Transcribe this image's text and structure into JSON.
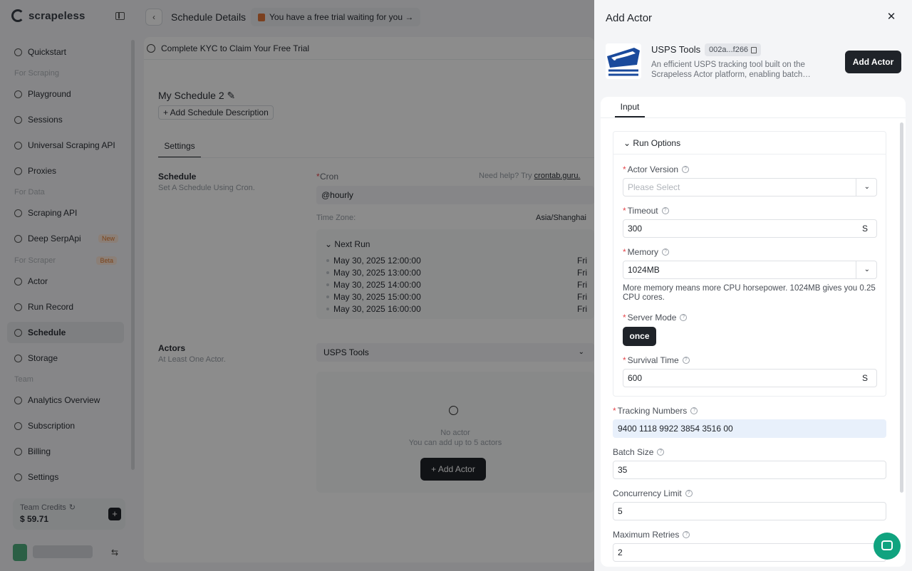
{
  "sidebar": {
    "brand": "scrapeless",
    "items": [
      {
        "label": "Quickstart",
        "icon": "rocket-icon"
      },
      {
        "label": "Playground",
        "icon": "grid-icon"
      },
      {
        "label": "Sessions",
        "icon": "session-icon"
      },
      {
        "label": "Universal Scraping API",
        "icon": "lock-icon"
      },
      {
        "label": "Proxies",
        "icon": "globe-icon"
      },
      {
        "label": "Scraping API",
        "icon": "api-icon"
      },
      {
        "label": "Deep SerpApi",
        "icon": "search-icon",
        "badge": "New"
      },
      {
        "label": "Actor",
        "icon": "actor-icon"
      },
      {
        "label": "Run Record",
        "icon": "record-icon"
      },
      {
        "label": "Schedule",
        "icon": "clock-icon"
      },
      {
        "label": "Storage",
        "icon": "storage-icon"
      },
      {
        "label": "Analytics Overview",
        "icon": "chart-icon"
      },
      {
        "label": "Subscription",
        "icon": "subscription-icon"
      },
      {
        "label": "Billing",
        "icon": "billing-icon"
      },
      {
        "label": "Settings",
        "icon": "gear-icon"
      }
    ],
    "groups": {
      "scraping": "For Scraping",
      "data": "For Data",
      "scraper": "For Scraper",
      "scraper_badge": "Beta",
      "team": "Team"
    },
    "credits": {
      "label": "Team Credits",
      "value": "$ 59.71"
    }
  },
  "topbar": {
    "title": "Schedule Details",
    "trial": "You have a free trial waiting for you →"
  },
  "main": {
    "kyc": "Complete KYC to Claim Your Free Trial",
    "schedule_name": "My Schedule 2",
    "add_description": "+ Add Schedule Description",
    "tab": "Settings",
    "schedule_title": "Schedule",
    "schedule_sub": "Set A Schedule Using Cron.",
    "cron_label": "Cron",
    "cron_help": "Need help? Try",
    "cron_link": "crontab.guru.",
    "cron_value": "@hourly",
    "timezone_label": "Time Zone:",
    "timezone_value": "Asia/Shanghai",
    "next_run_title": "Next Run",
    "next_runs": [
      {
        "time": "May 30, 2025 12:00:00",
        "day": "Fri"
      },
      {
        "time": "May 30, 2025 13:00:00",
        "day": "Fri"
      },
      {
        "time": "May 30, 2025 14:00:00",
        "day": "Fri"
      },
      {
        "time": "May 30, 2025 15:00:00",
        "day": "Fri"
      },
      {
        "time": "May 30, 2025 16:00:00",
        "day": "Fri"
      }
    ],
    "actors_title": "Actors",
    "actors_sub": "At Least One Actor.",
    "actors_selected": "USPS Tools",
    "empty_title": "No actor",
    "empty_sub": "You can add up to 5 actors",
    "add_actor": "+ Add Actor"
  },
  "drawer": {
    "title": "Add Actor",
    "actor": {
      "name": "USPS Tools",
      "id": "002a...f266",
      "description": "An efficient USPS tracking tool built on the Scrapeless Actor platform, enabling batch…",
      "logo_text": "UNITED STATES POSTAL SERVICE"
    },
    "add_button": "Add Actor",
    "tab": "Input",
    "run_options": "Run Options",
    "fields": {
      "actor_version": {
        "label": "Actor Version",
        "placeholder": "Please Select"
      },
      "timeout": {
        "label": "Timeout",
        "value": "300",
        "suffix": "S"
      },
      "memory": {
        "label": "Memory",
        "value": "1024MB",
        "help": "More memory means more CPU horsepower. 1024MB gives you 0.25 CPU cores."
      },
      "server_mode": {
        "label": "Server Mode",
        "value": "once"
      },
      "survival_time": {
        "label": "Survival Time",
        "value": "600",
        "suffix": "S"
      },
      "tracking_numbers": {
        "label": "Tracking Numbers",
        "value": "9400 1118 9922 3854 3516 00"
      },
      "batch_size": {
        "label": "Batch Size",
        "value": "35"
      },
      "concurrency_limit": {
        "label": "Concurrency Limit",
        "value": "5"
      },
      "maximum_retries": {
        "label": "Maximum Retries",
        "value": "2"
      }
    }
  },
  "colors": {
    "accent": "#1f2329",
    "highlight": "#e8f0fb",
    "required": "#e5484d",
    "chat": "#10a37f"
  }
}
